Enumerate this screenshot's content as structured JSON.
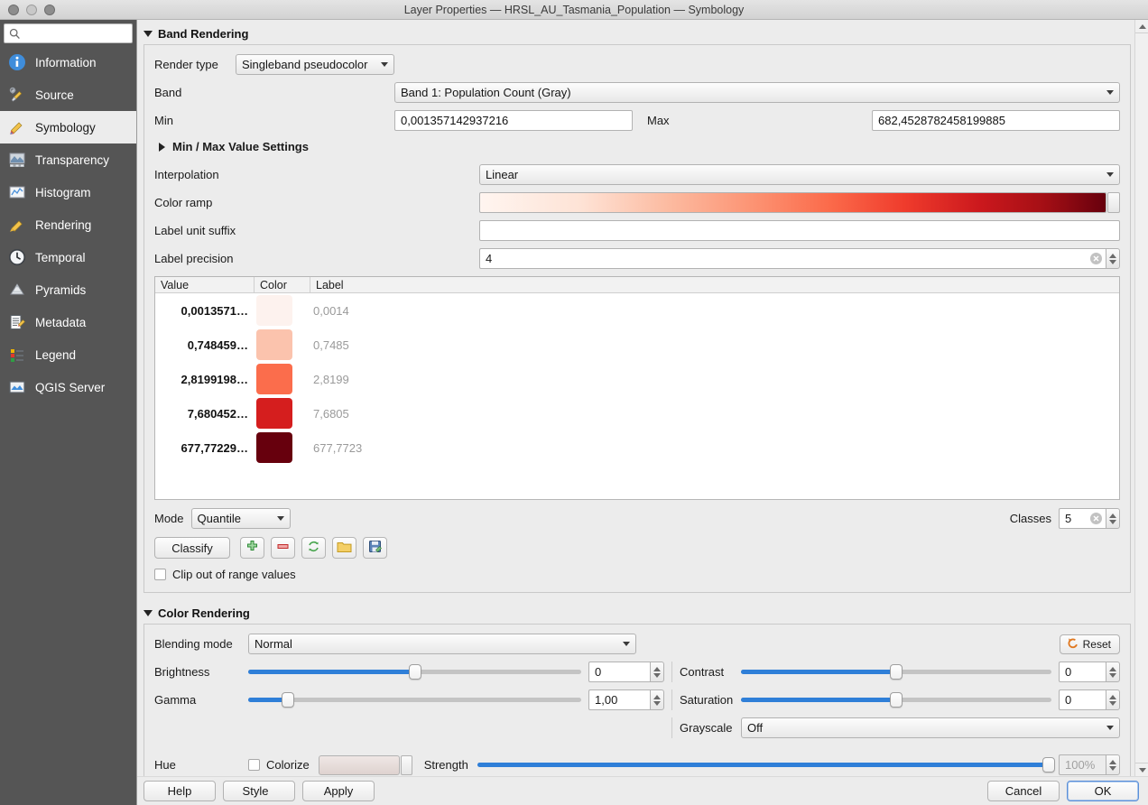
{
  "window": {
    "title": "Layer Properties — HRSL_AU_Tasmania_Population — Symbology"
  },
  "sidebar": {
    "search_placeholder": "",
    "items": [
      {
        "label": "Information",
        "icon": "info-icon",
        "active": false
      },
      {
        "label": "Source",
        "icon": "source-icon",
        "active": false
      },
      {
        "label": "Symbology",
        "icon": "symbology-icon",
        "active": true
      },
      {
        "label": "Transparency",
        "icon": "transparency-icon",
        "active": false
      },
      {
        "label": "Histogram",
        "icon": "histogram-icon",
        "active": false
      },
      {
        "label": "Rendering",
        "icon": "rendering-icon",
        "active": false
      },
      {
        "label": "Temporal",
        "icon": "clock-icon",
        "active": false
      },
      {
        "label": "Pyramids",
        "icon": "pyramids-icon",
        "active": false
      },
      {
        "label": "Metadata",
        "icon": "metadata-icon",
        "active": false
      },
      {
        "label": "Legend",
        "icon": "legend-icon",
        "active": false
      },
      {
        "label": "QGIS Server",
        "icon": "server-icon",
        "active": false
      }
    ]
  },
  "band_rendering": {
    "header": "Band Rendering",
    "render_type_label": "Render type",
    "render_type_value": "Singleband pseudocolor",
    "band_label": "Band",
    "band_value": "Band 1: Population Count (Gray)",
    "min_label": "Min",
    "min_value": "0,001357142937216",
    "max_label": "Max",
    "max_value": "682,4528782458199885",
    "minmax_settings_label": "Min / Max Value Settings",
    "interpolation_label": "Interpolation",
    "interpolation_value": "Linear",
    "color_ramp_label": "Color ramp",
    "color_ramp_name": "Reds",
    "label_unit_suffix_label": "Label unit suffix",
    "label_unit_suffix_value": "",
    "label_precision_label": "Label precision",
    "label_precision_value": "4",
    "table": {
      "headers": [
        "Value",
        "Color",
        "Label"
      ],
      "rows": [
        {
          "value": "0,0013571…",
          "color": "#fdf2ee",
          "label": "0,0014"
        },
        {
          "value": "0,748459…",
          "color": "#fbc3ad",
          "label": "0,7485"
        },
        {
          "value": "2,8199198…",
          "color": "#fb6d4c",
          "label": "2,8199"
        },
        {
          "value": "7,680452…",
          "color": "#d51e1e",
          "label": "7,6805"
        },
        {
          "value": "677,77229…",
          "color": "#67000d",
          "label": "677,7723"
        }
      ]
    },
    "mode_label": "Mode",
    "mode_value": "Quantile",
    "classes_label": "Classes",
    "classes_value": "5",
    "classify_label": "Classify",
    "toolbar_icons": [
      "add-entry-icon",
      "remove-entry-icon",
      "sort-entries-icon",
      "load-color-map-icon",
      "save-color-map-icon"
    ],
    "clip_label": "Clip out of range values",
    "clip_checked": false
  },
  "color_rendering": {
    "header": "Color Rendering",
    "blending_label": "Blending mode",
    "blending_value": "Normal",
    "brightness_label": "Brightness",
    "brightness_value": "0",
    "brightness_pct": 50,
    "contrast_label": "Contrast",
    "contrast_value": "0",
    "contrast_pct": 50,
    "gamma_label": "Gamma",
    "gamma_value": "1,00",
    "gamma_pct": 12,
    "saturation_label": "Saturation",
    "saturation_value": "0",
    "saturation_pct": 50,
    "grayscale_label": "Grayscale",
    "grayscale_value": "Off",
    "hue_label": "Hue",
    "colorize_label": "Colorize",
    "colorize_checked": false,
    "colorize_color": "#e4d7d4",
    "strength_label": "Strength",
    "strength_value": "100%",
    "strength_pct": 100,
    "reset_label": "Reset"
  },
  "footer": {
    "help": "Help",
    "style": "Style",
    "apply": "Apply",
    "cancel": "Cancel",
    "ok": "OK"
  },
  "colors": {
    "accent_blue": "#2f7fd8",
    "sidebar_bg": "#555555",
    "panel_bg": "#ececec"
  }
}
